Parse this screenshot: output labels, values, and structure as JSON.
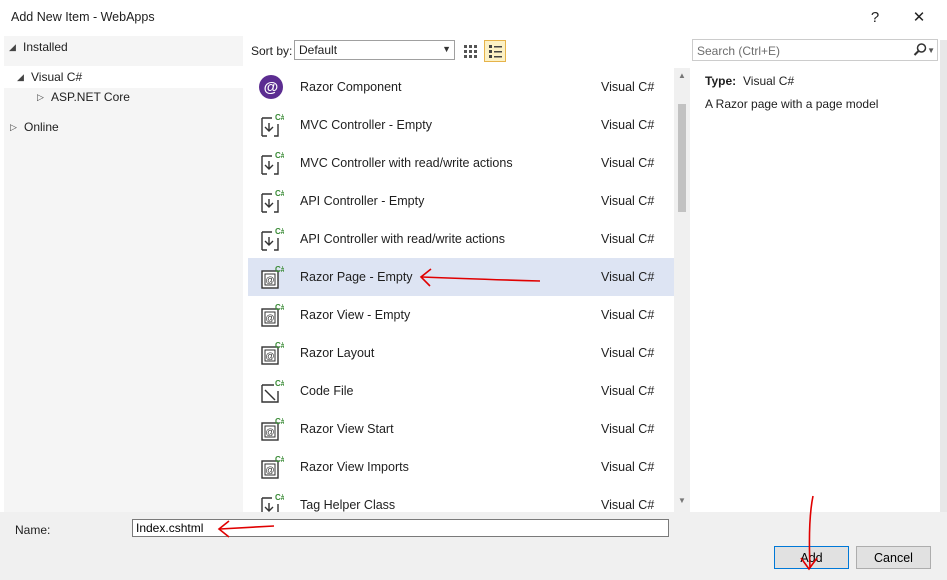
{
  "window": {
    "title": "Add New Item - WebApps",
    "help": "?",
    "close": "✕"
  },
  "tree": {
    "installed": "Installed",
    "visual_csharp": "Visual C#",
    "aspnet_core": "ASP.NET Core",
    "online": "Online"
  },
  "sortbar": {
    "label": "Sort by:",
    "value": "Default"
  },
  "search": {
    "placeholder": "Search (Ctrl+E)"
  },
  "templates": [
    {
      "name": "Razor Component",
      "lang": "Visual C#",
      "icon": "razor-component-icon"
    },
    {
      "name": "MVC Controller - Empty",
      "lang": "Visual C#",
      "icon": "controller-icon"
    },
    {
      "name": "MVC Controller with read/write actions",
      "lang": "Visual C#",
      "icon": "controller-icon"
    },
    {
      "name": "API Controller - Empty",
      "lang": "Visual C#",
      "icon": "controller-icon"
    },
    {
      "name": "API Controller with read/write actions",
      "lang": "Visual C#",
      "icon": "controller-icon"
    },
    {
      "name": "Razor Page - Empty",
      "lang": "Visual C#",
      "icon": "razor-page-icon",
      "selected": true
    },
    {
      "name": "Razor View - Empty",
      "lang": "Visual C#",
      "icon": "razor-page-icon"
    },
    {
      "name": "Razor Layout",
      "lang": "Visual C#",
      "icon": "razor-page-icon"
    },
    {
      "name": "Code File",
      "lang": "Visual C#",
      "icon": "code-file-icon"
    },
    {
      "name": "Razor View Start",
      "lang": "Visual C#",
      "icon": "razor-page-icon"
    },
    {
      "name": "Razor View Imports",
      "lang": "Visual C#",
      "icon": "razor-page-icon"
    },
    {
      "name": "Tag Helper Class",
      "lang": "Visual C#",
      "icon": "controller-icon"
    }
  ],
  "details": {
    "type_label": "Type:",
    "type_value": "Visual C#",
    "description": "A Razor page with a page model"
  },
  "bottom": {
    "name_label": "Name:",
    "name_value": "Index.cshtml",
    "add_label": "Add",
    "cancel_label": "Cancel"
  },
  "colors": {
    "accent": "#0078d7",
    "selection": "#dde4f3",
    "csharp_badge": "#388a34",
    "annotation": "#e00000"
  }
}
